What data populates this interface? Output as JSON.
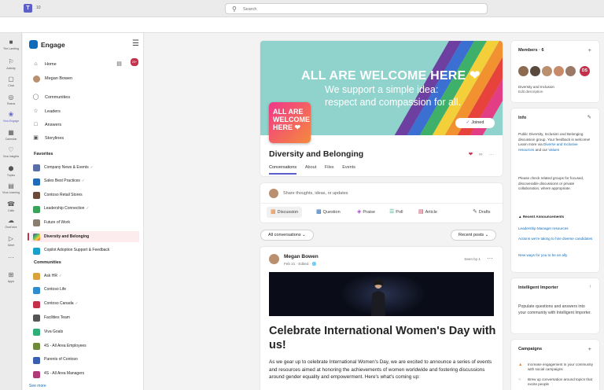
{
  "topbar": {
    "back_label": "10",
    "search_placeholder": "Search"
  },
  "rail": [
    {
      "label": "The Landing",
      "icon": "landing-icon"
    },
    {
      "label": "Activity",
      "icon": "bell-icon"
    },
    {
      "label": "Chat",
      "icon": "chat-icon"
    },
    {
      "label": "Teams",
      "icon": "teams-icon"
    },
    {
      "label": "Viva Engage",
      "icon": "engage-icon"
    },
    {
      "label": "Calendar",
      "icon": "calendar-icon"
    },
    {
      "label": "Viva Insights",
      "icon": "insights-icon"
    },
    {
      "label": "Topics",
      "icon": "topics-icon"
    },
    {
      "label": "Viva Learning",
      "icon": "learning-icon"
    },
    {
      "label": "Calls",
      "icon": "phone-icon"
    },
    {
      "label": "OneDrive",
      "icon": "cloud-icon"
    },
    {
      "label": "Meet",
      "icon": "video-icon"
    },
    {
      "label": "...",
      "icon": "more-icon"
    },
    {
      "label": "Apps",
      "icon": "apps-icon"
    }
  ],
  "sidebar": {
    "app_title": "Engage",
    "notification_count": "20+",
    "nav": [
      {
        "label": "Home"
      },
      {
        "label": "Megan Bowen"
      },
      {
        "label": "Communities"
      },
      {
        "label": "Leaders"
      },
      {
        "label": "Answers"
      },
      {
        "label": "Storylines"
      }
    ],
    "favorites_header": "Favorites",
    "favorites": [
      {
        "label": "Company News & Events",
        "verified": true,
        "color": "#5b6ea8"
      },
      {
        "label": "Sales Best Practices",
        "verified": true,
        "color": "#1f6bb8"
      },
      {
        "label": "Contoso Retail Stores",
        "verified": false,
        "color": "#6b4a3a"
      },
      {
        "label": "Leadership Connection",
        "verified": true,
        "color": "#3aa35a"
      },
      {
        "label": "Future of Work",
        "verified": false,
        "color": "#8a7e6e"
      },
      {
        "label": "Diversity and Belonging",
        "verified": false,
        "color": "#e5567f"
      },
      {
        "label": "Copilot Adoption Support & Feedback",
        "verified": false,
        "color": "#1aa0c9"
      }
    ],
    "communities_header": "Communities",
    "communities": [
      {
        "label": "Ask HR",
        "verified": true,
        "color": "#d9a23a"
      },
      {
        "label": "Contoso Life",
        "verified": false,
        "color": "#2e8bd0"
      },
      {
        "label": "Contoso Canada",
        "verified": true,
        "color": "#c4314b"
      },
      {
        "label": "Facilities Team",
        "verified": false,
        "color": "#555555"
      },
      {
        "label": "Viva Goals",
        "verified": false,
        "color": "#2fae7a"
      },
      {
        "label": "4S - All Area Employees",
        "verified": false,
        "color": "#6e8a3a"
      },
      {
        "label": "Parents of Contoso",
        "verified": false,
        "color": "#3a5fb0"
      },
      {
        "label": "4S - All Area Managers",
        "verified": false,
        "color": "#b03a78"
      }
    ],
    "see_more": "See more"
  },
  "group": {
    "banner_title": "ALL ARE WELCOME HERE ❤",
    "banner_sub1": "We support a simple idea:",
    "banner_sub2": "respect and compassion for all.",
    "badge_text": [
      "ALL ARE",
      "WELCOME",
      "HERE ❤"
    ],
    "joined_label": "Joined",
    "title": "Diversity and Belonging",
    "tabs": [
      "Conversations",
      "About",
      "Files",
      "Events"
    ]
  },
  "composer": {
    "placeholder": "Share thoughts, ideas, or updates",
    "options": [
      "Discussion",
      "Question",
      "Praise",
      "Poll",
      "Article"
    ],
    "drafts": "Drafts"
  },
  "filters": {
    "left": "All conversations",
    "right": "Recent posts"
  },
  "post": {
    "author": "Megan Bowen",
    "meta": "Feb 21  ·  Edited  ·  🌐",
    "seen": "Seen by 1",
    "headline": "Celebrate International Women's Day with us!",
    "body": "As we gear up to celebrate International Women's Day, we are excited to announce a series of events and resources aimed at honoring the achievements of women worldwide and fostering discussions around gender equality and empowerment. Here's what's coming up:"
  },
  "members": {
    "title": "Members",
    "count": "6",
    "initials_last": "DS",
    "group_name": "Diversity and Inclusion",
    "edit": "Edit description"
  },
  "info": {
    "title": "Info",
    "desc1": "Public Diversity, Inclusion and Belonging discussion group. Your feedback is welcome! Learn more via",
    "link1": "Diverse and Inclusive resources",
    "desc_and": "and our",
    "link2": "Values",
    "desc2": "Please check related groups for focused, discoverable discussions or private collaboration, where appropriate.",
    "announcements_title": "Recent Announcements",
    "announcements": [
      "Leadership Manager resources",
      "Actions we're taking to hire diverse candidates",
      "New ways for you to be an ally"
    ]
  },
  "importer": {
    "title": "Intelligent Importer",
    "desc": "Populate questions and answers into your community with Intelligent Importer."
  },
  "campaigns": {
    "title": "Campaigns",
    "items": [
      "Increase engagement in your community with social campaigns",
      "Brew up conversation around topics that excite people"
    ]
  }
}
